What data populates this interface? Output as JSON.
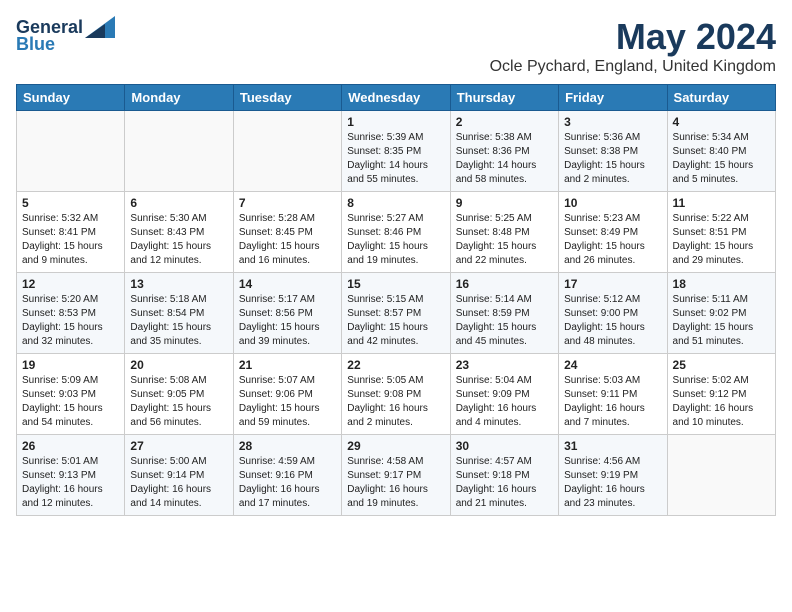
{
  "logo": {
    "text_general": "General",
    "text_blue": "Blue"
  },
  "title": "May 2024",
  "location": "Ocle Pychard, England, United Kingdom",
  "headers": [
    "Sunday",
    "Monday",
    "Tuesday",
    "Wednesday",
    "Thursday",
    "Friday",
    "Saturday"
  ],
  "weeks": [
    [
      {
        "day": "",
        "info": ""
      },
      {
        "day": "",
        "info": ""
      },
      {
        "day": "",
        "info": ""
      },
      {
        "day": "1",
        "info": "Sunrise: 5:39 AM\nSunset: 8:35 PM\nDaylight: 14 hours\nand 55 minutes."
      },
      {
        "day": "2",
        "info": "Sunrise: 5:38 AM\nSunset: 8:36 PM\nDaylight: 14 hours\nand 58 minutes."
      },
      {
        "day": "3",
        "info": "Sunrise: 5:36 AM\nSunset: 8:38 PM\nDaylight: 15 hours\nand 2 minutes."
      },
      {
        "day": "4",
        "info": "Sunrise: 5:34 AM\nSunset: 8:40 PM\nDaylight: 15 hours\nand 5 minutes."
      }
    ],
    [
      {
        "day": "5",
        "info": "Sunrise: 5:32 AM\nSunset: 8:41 PM\nDaylight: 15 hours\nand 9 minutes."
      },
      {
        "day": "6",
        "info": "Sunrise: 5:30 AM\nSunset: 8:43 PM\nDaylight: 15 hours\nand 12 minutes."
      },
      {
        "day": "7",
        "info": "Sunrise: 5:28 AM\nSunset: 8:45 PM\nDaylight: 15 hours\nand 16 minutes."
      },
      {
        "day": "8",
        "info": "Sunrise: 5:27 AM\nSunset: 8:46 PM\nDaylight: 15 hours\nand 19 minutes."
      },
      {
        "day": "9",
        "info": "Sunrise: 5:25 AM\nSunset: 8:48 PM\nDaylight: 15 hours\nand 22 minutes."
      },
      {
        "day": "10",
        "info": "Sunrise: 5:23 AM\nSunset: 8:49 PM\nDaylight: 15 hours\nand 26 minutes."
      },
      {
        "day": "11",
        "info": "Sunrise: 5:22 AM\nSunset: 8:51 PM\nDaylight: 15 hours\nand 29 minutes."
      }
    ],
    [
      {
        "day": "12",
        "info": "Sunrise: 5:20 AM\nSunset: 8:53 PM\nDaylight: 15 hours\nand 32 minutes."
      },
      {
        "day": "13",
        "info": "Sunrise: 5:18 AM\nSunset: 8:54 PM\nDaylight: 15 hours\nand 35 minutes."
      },
      {
        "day": "14",
        "info": "Sunrise: 5:17 AM\nSunset: 8:56 PM\nDaylight: 15 hours\nand 39 minutes."
      },
      {
        "day": "15",
        "info": "Sunrise: 5:15 AM\nSunset: 8:57 PM\nDaylight: 15 hours\nand 42 minutes."
      },
      {
        "day": "16",
        "info": "Sunrise: 5:14 AM\nSunset: 8:59 PM\nDaylight: 15 hours\nand 45 minutes."
      },
      {
        "day": "17",
        "info": "Sunrise: 5:12 AM\nSunset: 9:00 PM\nDaylight: 15 hours\nand 48 minutes."
      },
      {
        "day": "18",
        "info": "Sunrise: 5:11 AM\nSunset: 9:02 PM\nDaylight: 15 hours\nand 51 minutes."
      }
    ],
    [
      {
        "day": "19",
        "info": "Sunrise: 5:09 AM\nSunset: 9:03 PM\nDaylight: 15 hours\nand 54 minutes."
      },
      {
        "day": "20",
        "info": "Sunrise: 5:08 AM\nSunset: 9:05 PM\nDaylight: 15 hours\nand 56 minutes."
      },
      {
        "day": "21",
        "info": "Sunrise: 5:07 AM\nSunset: 9:06 PM\nDaylight: 15 hours\nand 59 minutes."
      },
      {
        "day": "22",
        "info": "Sunrise: 5:05 AM\nSunset: 9:08 PM\nDaylight: 16 hours\nand 2 minutes."
      },
      {
        "day": "23",
        "info": "Sunrise: 5:04 AM\nSunset: 9:09 PM\nDaylight: 16 hours\nand 4 minutes."
      },
      {
        "day": "24",
        "info": "Sunrise: 5:03 AM\nSunset: 9:11 PM\nDaylight: 16 hours\nand 7 minutes."
      },
      {
        "day": "25",
        "info": "Sunrise: 5:02 AM\nSunset: 9:12 PM\nDaylight: 16 hours\nand 10 minutes."
      }
    ],
    [
      {
        "day": "26",
        "info": "Sunrise: 5:01 AM\nSunset: 9:13 PM\nDaylight: 16 hours\nand 12 minutes."
      },
      {
        "day": "27",
        "info": "Sunrise: 5:00 AM\nSunset: 9:14 PM\nDaylight: 16 hours\nand 14 minutes."
      },
      {
        "day": "28",
        "info": "Sunrise: 4:59 AM\nSunset: 9:16 PM\nDaylight: 16 hours\nand 17 minutes."
      },
      {
        "day": "29",
        "info": "Sunrise: 4:58 AM\nSunset: 9:17 PM\nDaylight: 16 hours\nand 19 minutes."
      },
      {
        "day": "30",
        "info": "Sunrise: 4:57 AM\nSunset: 9:18 PM\nDaylight: 16 hours\nand 21 minutes."
      },
      {
        "day": "31",
        "info": "Sunrise: 4:56 AM\nSunset: 9:19 PM\nDaylight: 16 hours\nand 23 minutes."
      },
      {
        "day": "",
        "info": ""
      }
    ]
  ]
}
